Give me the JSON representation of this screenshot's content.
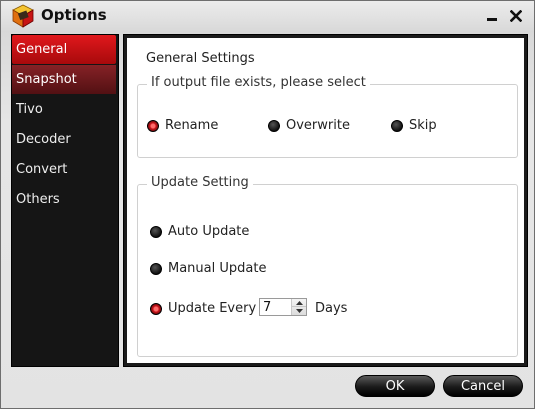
{
  "window": {
    "title": "Options"
  },
  "sidebar": {
    "items": [
      {
        "label": "General"
      },
      {
        "label": "Snapshot"
      },
      {
        "label": "Tivo"
      },
      {
        "label": "Decoder"
      },
      {
        "label": "Convert"
      },
      {
        "label": "Others"
      }
    ],
    "active_index": 0
  },
  "main": {
    "section_title": "General Settings",
    "output_group": {
      "label": "If output file exists, please select",
      "options": [
        {
          "label": "Rename",
          "checked": true
        },
        {
          "label": "Overwrite",
          "checked": false
        },
        {
          "label": "Skip",
          "checked": false
        }
      ]
    },
    "update_group": {
      "label": "Update Setting",
      "options": [
        {
          "label": "Auto Update",
          "checked": false
        },
        {
          "label": "Manual Update",
          "checked": false
        },
        {
          "label": "Update Every",
          "checked": true
        }
      ],
      "interval_value": "7",
      "interval_unit": "Days"
    }
  },
  "footer": {
    "ok_label": "OK",
    "cancel_label": "Cancel"
  },
  "colors": {
    "accent": "#c8141a",
    "sidebar_bg": "#151515",
    "button_bg": "#1a1a1a"
  }
}
